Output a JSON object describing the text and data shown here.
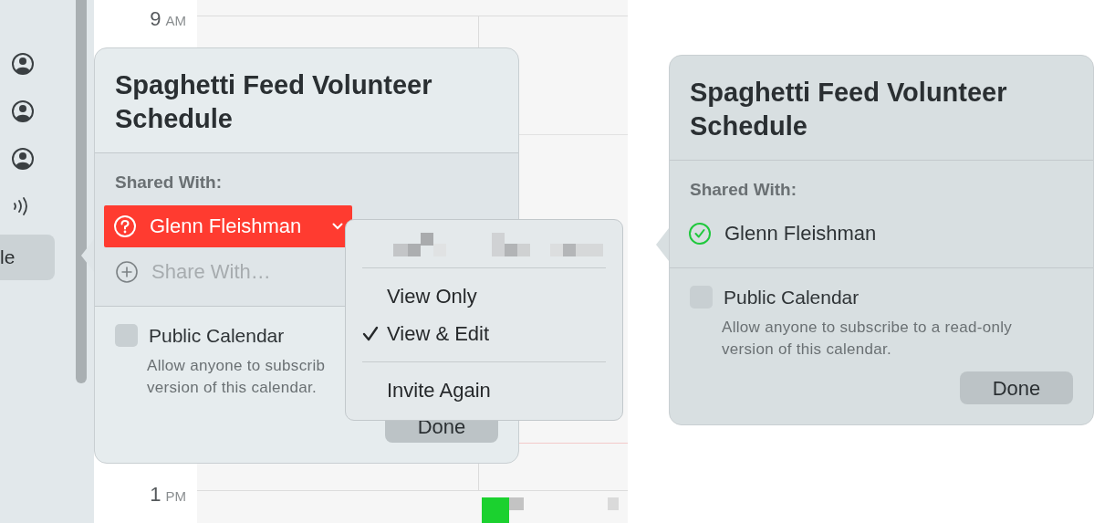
{
  "calendar": {
    "sidebar": {
      "items": [
        {
          "kind": "account"
        },
        {
          "kind": "account"
        },
        {
          "kind": "account"
        },
        {
          "kind": "delegate"
        },
        {
          "kind": "calendar",
          "label": "le",
          "selected": true
        }
      ]
    },
    "hours": [
      {
        "hour": "9",
        "period": "AM"
      },
      {
        "hour": "1",
        "period": "PM"
      }
    ]
  },
  "left_popover": {
    "title": "Spaghetti Feed Volunteer Schedule",
    "shared_with_label": "Shared With:",
    "invitees": [
      {
        "name": "Glenn Fleishman",
        "kind": "pending",
        "selected": true
      }
    ],
    "share_field": {
      "placeholder": "Share With…"
    },
    "public_calendar": {
      "label": "Public Calendar",
      "checked": false,
      "description_lines": [
        "Allow anyone to subscrib",
        "version of this calendar."
      ]
    },
    "done_button": "Done"
  },
  "invitee_menu": {
    "items": [
      {
        "kind": "redacted"
      },
      {
        "kind": "separator"
      },
      {
        "kind": "option",
        "label": "View Only",
        "checked": false
      },
      {
        "kind": "option",
        "label": "View & Edit",
        "checked": true
      },
      {
        "kind": "separator"
      },
      {
        "kind": "action",
        "label": "Invite Again"
      }
    ]
  },
  "right_popover": {
    "title": "Spaghetti Feed Volunteer Schedule",
    "shared_with_label": "Shared With:",
    "invitees": [
      {
        "name": "Glenn Fleishman",
        "kind": "accepted",
        "selected": false
      }
    ],
    "public_calendar": {
      "label": "Public Calendar",
      "checked": false,
      "description_lines": [
        "Allow anyone to subscribe to a read-only",
        "version of this calendar."
      ]
    },
    "done_button": "Done"
  }
}
